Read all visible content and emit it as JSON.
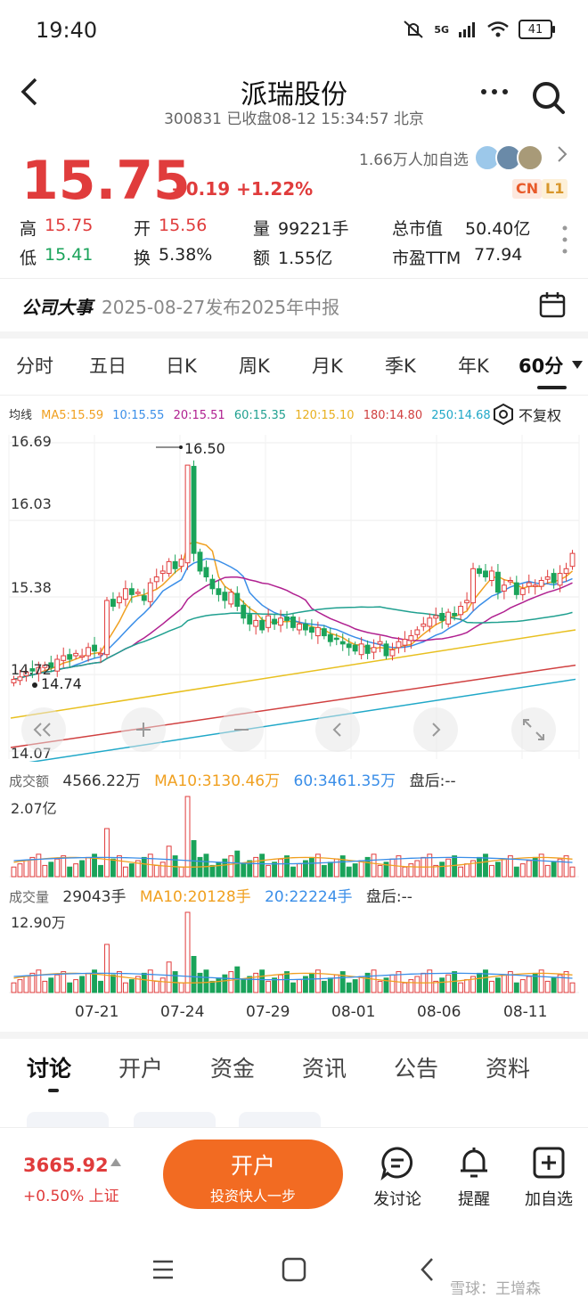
{
  "status": {
    "time": "19:40",
    "network": "5G",
    "battery": "41"
  },
  "header": {
    "title": "派瑞股份",
    "subtitle": "300831 已收盘08-12 15:34:57 北京"
  },
  "quote": {
    "price": "15.75",
    "change": "+0.19 +1.22%",
    "followers": "1.66万人加自选",
    "tag_cn": "CN",
    "tag_l1": "L1"
  },
  "stats": {
    "high_label": "高",
    "high": "15.75",
    "open_label": "开",
    "open": "15.56",
    "volume_label": "量",
    "volume": "99221手",
    "mcap_label": "总市值",
    "mcap": "50.40亿",
    "low_label": "低",
    "low": "15.41",
    "turnover_label": "换",
    "turnover": "5.38%",
    "amount_label": "额",
    "amount": "1.55亿",
    "pe_label": "市盈TTM",
    "pe": "77.94"
  },
  "event": {
    "label": "公司大事",
    "text": "2025-08-27发布2025年中报"
  },
  "period_tabs": [
    "分时",
    "五日",
    "日K",
    "周K",
    "月K",
    "季K",
    "年K",
    "60分"
  ],
  "ma": {
    "label": "均线",
    "ma5": "MA5:15.59",
    "ma10": "10:15.55",
    "ma20": "20:15.51",
    "ma60": "60:15.35",
    "ma120": "120:15.10",
    "ma180": "180:14.80",
    "ma250": "250:14.68",
    "adjust": "不复权"
  },
  "colors": {
    "up": "#e03c3c",
    "down": "#1aa35a",
    "ma5": "#f0a020",
    "ma10": "#3a8ee8",
    "ma20": "#b02090",
    "ma60": "#20a090",
    "ma120": "#e8c020",
    "ma180": "#d04040",
    "ma250": "#20a8c8"
  },
  "kline": {
    "ticks": [
      "16.69",
      "16.03",
      "15.38",
      "14.72",
      "14.07"
    ],
    "high_mark": "16.50",
    "low_mark": "14.74"
  },
  "amount_panel": {
    "label": "成交额",
    "value": "4566.22万",
    "ma10": "MA10:3130.46万",
    "ma60": "60:3461.35万",
    "after": "盘后:--",
    "max": "2.07亿"
  },
  "volume_panel": {
    "label": "成交量",
    "value": "29043手",
    "ma10": "MA10:20128手",
    "ma20": "20:22224手",
    "after": "盘后:--",
    "max": "12.90万"
  },
  "dates": [
    "07-21",
    "07-24",
    "07-29",
    "08-01",
    "08-06",
    "08-11"
  ],
  "bottom_tabs": [
    "讨论",
    "开户",
    "资金",
    "资讯",
    "公告",
    "资料"
  ],
  "index": {
    "value": "3665.92",
    "change": "+0.50% 上证"
  },
  "open_button": {
    "line1": "开户",
    "line2": "投资快人一步"
  },
  "actions": {
    "discuss": "发讨论",
    "remind": "提醒",
    "add": "加自选"
  },
  "watermark": "雪球：王增森"
}
